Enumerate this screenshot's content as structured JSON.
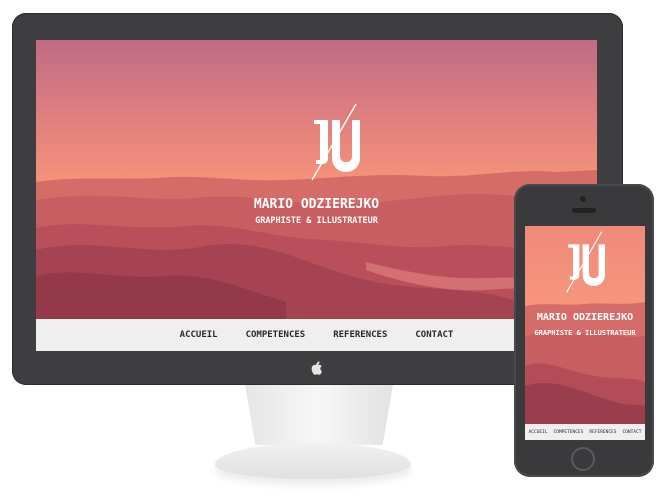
{
  "site": {
    "name": "MARIO ODZIEREJKO",
    "tagline": "GRAPHISTE & ILLUSTRATEUR",
    "nav": [
      {
        "label": "ACCUEIL"
      },
      {
        "label": "COMPETENCES"
      },
      {
        "label": "REFERENCES"
      },
      {
        "label": "CONTACT"
      }
    ]
  },
  "colors": {
    "hero_top": "#c06c86",
    "hero_mid": "#f5967c",
    "hero_bottom": "#c85a5e",
    "nav_background": "#efefef",
    "device_frame": "#3e3e40"
  },
  "icons": {
    "monitor_brand": "apple-icon",
    "logo": "mo-monogram-icon"
  }
}
